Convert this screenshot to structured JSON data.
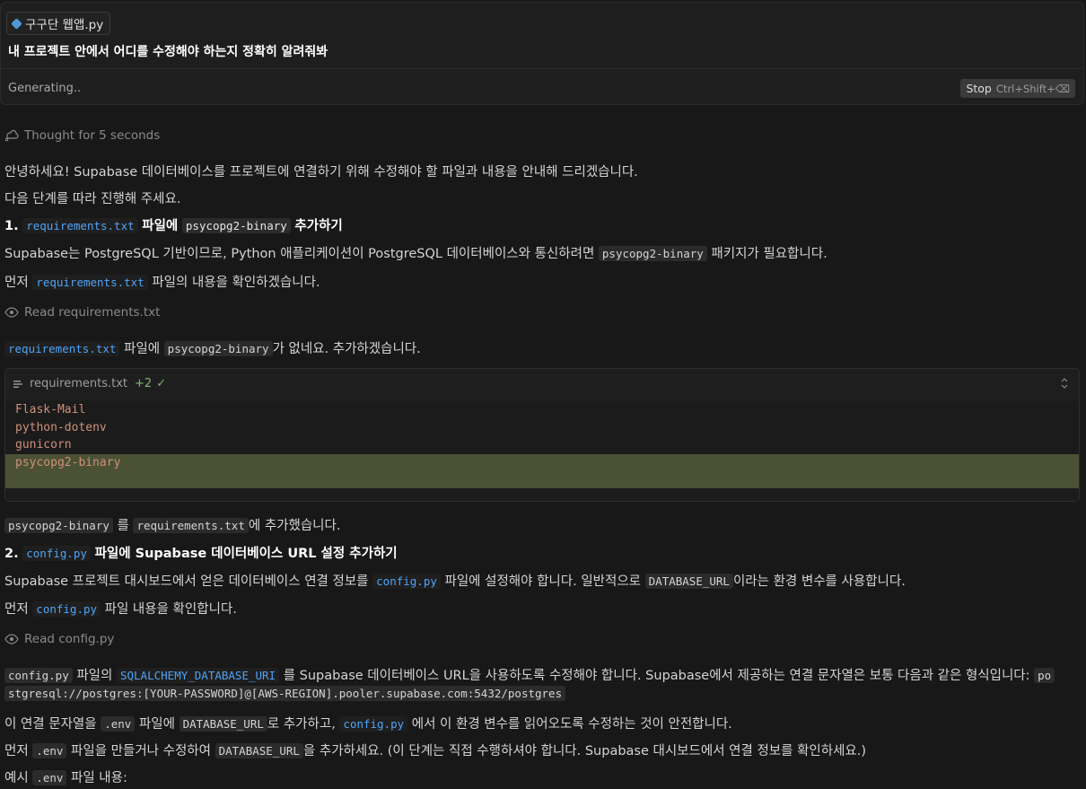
{
  "prompt": {
    "file_chip": "구구단 웹앱.py",
    "text": "내 프로젝트 안에서 어디를 수정해야 하는지 정확히 알려줘봐",
    "status": "Generating..",
    "stop_label": "Stop",
    "stop_shortcut": "Ctrl+Shift+⌫"
  },
  "thought": "Thought for 5 seconds",
  "intro1": "안녕하세요! Supabase 데이터베이스를 프로젝트에 연결하기 위해 수정해야 할 파일과 내용을 안내해 드리겠습니다.",
  "intro2": "다음 단계를 따라 진행해 주세요.",
  "step1": {
    "num": "1.",
    "file": "requirements.txt",
    "mid": "파일에",
    "pkg": "psycopg2-binary",
    "end": "추가하기",
    "desc_a": "Supabase는 PostgreSQL 기반이므로, Python 애플리케이션이 PostgreSQL 데이터베이스와 통신하려면",
    "desc_code": "psycopg2-binary",
    "desc_b": "패키지가 필요합니다.",
    "check_a": "먼저",
    "check_code": "requirements.txt",
    "check_b": "파일의 내용을 확인하겠습니다.",
    "read": "Read requirements.txt",
    "result_code1": "requirements.txt",
    "result_a": "파일에",
    "result_code2": "psycopg2-binary",
    "result_b": "가 없네요. 추가하겠습니다."
  },
  "code_block": {
    "filename": "requirements.txt",
    "diff": "+2",
    "lines": [
      "Flask-Mail",
      "python-dotenv",
      "gunicorn",
      "psycopg2-binary"
    ]
  },
  "added": {
    "code1": "psycopg2-binary",
    "a": "를",
    "code2": "requirements.txt",
    "b": "에 추가했습니다."
  },
  "step2": {
    "num": "2.",
    "file": "config.py",
    "title": "파일에 Supabase 데이터베이스 URL 설정 추가하기",
    "desc_a": "Supabase 프로젝트 대시보드에서 얻은 데이터베이스 연결 정보를",
    "desc_code1": "config.py",
    "desc_b": "파일에 설정해야 합니다. 일반적으로",
    "desc_code2": "DATABASE_URL",
    "desc_c": "이라는 환경 변수를 사용합니다.",
    "check_a": "먼저",
    "check_code": "config.py",
    "check_b": "파일 내용을 확인합니다.",
    "read": "Read config.py",
    "r1_code1": "config.py",
    "r1_a": "파일의",
    "r1_code2": "SQLALCHEMY_DATABASE_URI",
    "r1_b": "를 Supabase 데이터베이스 URL을 사용하도록 수정해야 합니다. Supabase에서 제공하는 연결 문자열은 보통 다음과 같은 형식입니다:",
    "r1_tail": "po",
    "r1_cont": "stgresql://postgres:[YOUR-PASSWORD]@[AWS-REGION].pooler.supabase.com:5432/postgres",
    "r2_a": "이 연결 문자열을",
    "r2_code1": ".env",
    "r2_b": "파일에",
    "r2_code2": "DATABASE_URL",
    "r2_c": "로 추가하고,",
    "r2_code3": "config.py",
    "r2_d": "에서 이 환경 변수를 읽어오도록 수정하는 것이 안전합니다.",
    "r3_a": "먼저",
    "r3_code1": ".env",
    "r3_b": "파일을 만들거나 수정하여",
    "r3_code2": "DATABASE_URL",
    "r3_c": "을 추가하세요. (이 단계는 직접 수행하셔야 합니다. Supabase 대시보드에서 연결 정보를 확인하세요.)",
    "r4_a": "예시",
    "r4_code": ".env",
    "r4_b": "파일 내용:"
  },
  "icons": {
    "chip": "python-file-icon",
    "thought": "brain-icon",
    "read": "eye-icon",
    "file": "lines-icon",
    "expand": "chevron-updown-icon"
  }
}
